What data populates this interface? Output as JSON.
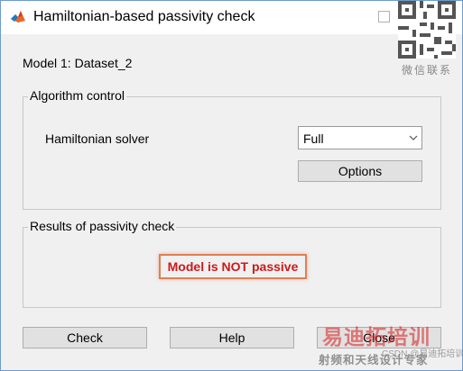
{
  "window": {
    "title": "Hamiltonian-based passivity check",
    "icon": "matlab-icon"
  },
  "model_label": "Model 1: Dataset_2",
  "algorithm_control": {
    "title": "Algorithm control",
    "solver_label": "Hamiltonian solver",
    "solver_value": "Full",
    "options_label": "Options"
  },
  "results": {
    "title": "Results of passivity check",
    "status": "Model is NOT passive",
    "status_color": "#cc1a1a",
    "highlight_color": "#e37d55"
  },
  "buttons": {
    "check": "Check",
    "help": "Help",
    "close": "Close"
  },
  "watermark": {
    "qr_caption": "微信联系",
    "brand": "易迪拓培训",
    "slogan": "射频和天线设计专家",
    "csdn": "CSDN @易迪拓培训"
  }
}
